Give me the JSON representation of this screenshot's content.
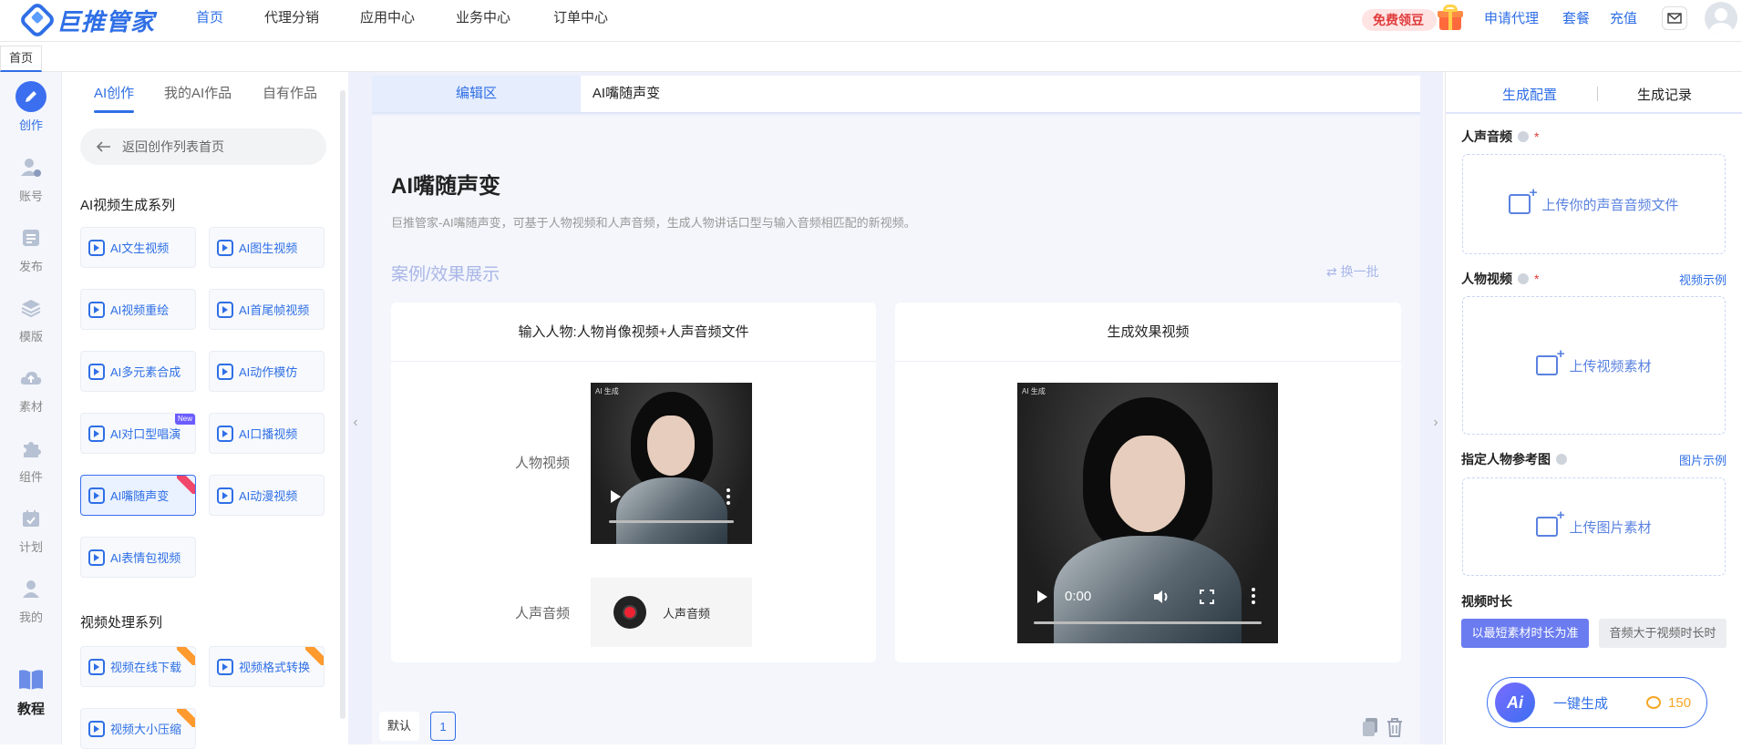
{
  "topnav": {
    "logo_text": "巨推管家",
    "nav": [
      "首页",
      "代理分销",
      "应用中心",
      "业务中心",
      "订单中心"
    ],
    "free_label": "免费领豆",
    "links": [
      "申请代理",
      "套餐",
      "充值"
    ]
  },
  "tabstrip": {
    "home": "首页"
  },
  "iconbar": {
    "items": [
      "创作",
      "账号",
      "发布",
      "模版",
      "素材",
      "组件",
      "计划",
      "我的"
    ],
    "tutorial": "教程"
  },
  "fnpanel": {
    "tabs": [
      "AI创作",
      "我的AI作品",
      "自有作品"
    ],
    "back_label": "返回创作列表首页",
    "section1": "AI视频生成系列",
    "section2": "视频处理系列",
    "buttons": [
      "AI文生视频",
      "AI图生视频",
      "AI视频重绘",
      "AI首尾帧视频",
      "AI多元素合成",
      "AI动作模仿",
      "AI对口型唱演",
      "AI口播视频",
      "AI嘴随声变",
      "AI动漫视频",
      "AI表情包视频"
    ],
    "tools": [
      "视频在线下载",
      "视频格式转换",
      "视频大小压缩"
    ]
  },
  "main": {
    "tabs": [
      "编辑区",
      "AI嘴随声变"
    ],
    "title": "AI嘴随声变",
    "desc": "巨推管家-AI嘴随声变，可基于人物视频和人声音频，生成人物讲话口型与输入音频相匹配的新视频。",
    "case_title": "案例/效果展示",
    "refresh": "换一批",
    "left_card": {
      "header": "输入人物:人物肖像视频+人声音频文件",
      "video_label": "人物视频",
      "audio_label": "人声音频",
      "audio_name": "人声音频"
    },
    "right_card": {
      "header": "生成效果视频",
      "time": "0:00"
    },
    "pager": {
      "default": "默认",
      "page": "1"
    }
  },
  "rpanel": {
    "tabs": [
      "生成配置",
      "生成记录"
    ],
    "voice_label": "人声音频",
    "voice_upload": "上传你的声音音频文件",
    "video_label": "人物视频",
    "video_link": "视频示例",
    "video_upload": "上传视频素材",
    "ref_label": "指定人物参考图",
    "ref_link": "图片示例",
    "ref_upload": "上传图片素材",
    "duration_label": "视频时长",
    "seg_options": [
      "以最短素材时长为准",
      "音频大于视频时长时"
    ],
    "generate_label": "一键生成",
    "ai_badge": "Ai",
    "cost": "150"
  },
  "colors": {
    "accent": "#2f6fe6",
    "purple": "#6b5cff",
    "main_bg": "#eef1fb"
  }
}
